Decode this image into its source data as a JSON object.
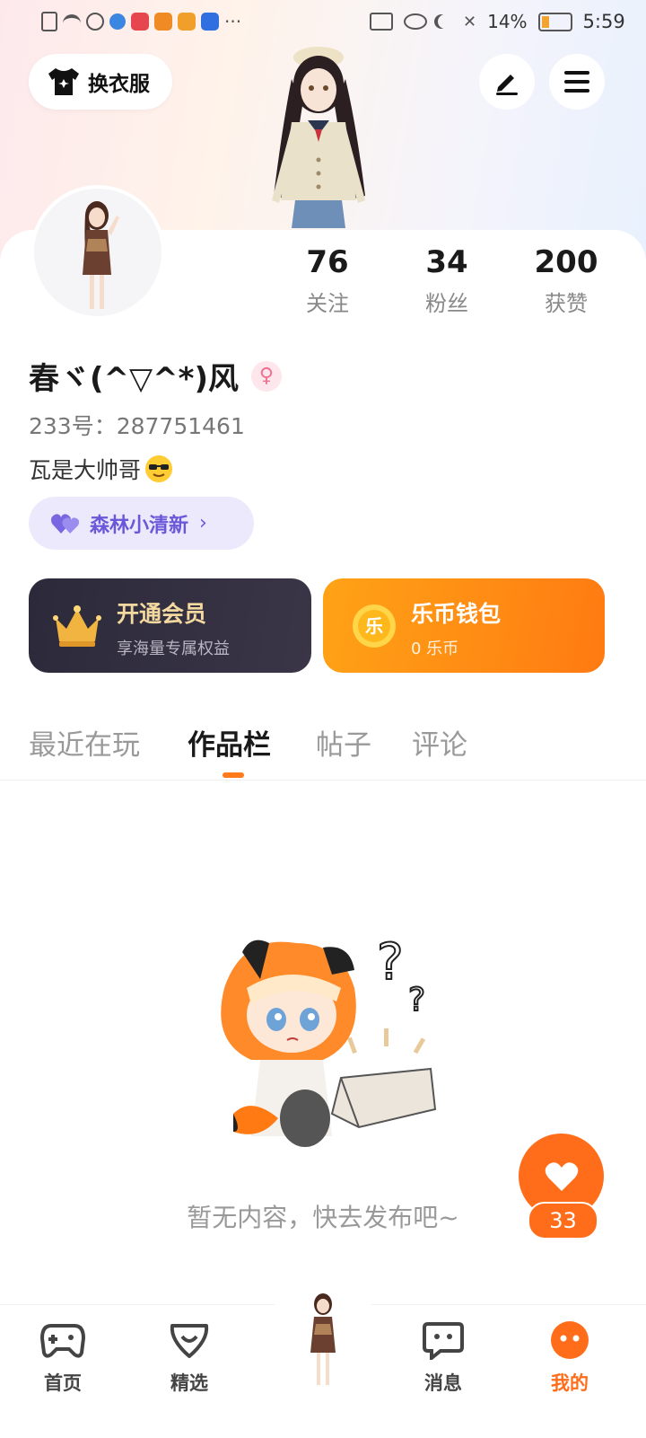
{
  "status_bar": {
    "battery": "14%",
    "time": "5:59"
  },
  "header": {
    "outfit_label": "换衣服",
    "edit_icon": "pen-icon",
    "menu_icon": "hamburger-menu-icon"
  },
  "profile": {
    "stats": [
      {
        "value": "76",
        "label": "关注"
      },
      {
        "value": "34",
        "label": "粉丝"
      },
      {
        "value": "200",
        "label": "获赞"
      }
    ],
    "username": "春ヾ(^▽^*)风",
    "gender_symbol": "♀",
    "uid": "233号：287751461",
    "bio": "瓦是大帅哥",
    "tag": "森林小清新"
  },
  "cards": {
    "vip_title": "开通会员",
    "vip_subtitle": "享海量专属权益",
    "wallet_title": "乐币钱包",
    "wallet_subtitle": "0 乐币",
    "coin_char": "乐"
  },
  "tabs": [
    {
      "label": "最近在玩",
      "active": false
    },
    {
      "label": "作品栏",
      "active": true
    },
    {
      "label": "帖子",
      "active": false
    },
    {
      "label": "评论",
      "active": false
    }
  ],
  "empty_state": {
    "text": "暂无内容，快去发布吧~"
  },
  "fab": {
    "count": "33"
  },
  "bottom_nav": [
    {
      "label": "首页",
      "icon": "gamepad-icon"
    },
    {
      "label": "精选",
      "icon": "heart-shield-icon"
    },
    {
      "label": "",
      "icon": "avatar-icon"
    },
    {
      "label": "消息",
      "icon": "chat-bubble-icon"
    },
    {
      "label": "我的",
      "icon": "profile-face-icon",
      "active": true
    }
  ],
  "colors": {
    "accent": "#ff6d1a",
    "tag_purple": "#6a58d8",
    "vip_gold": "#f3d9a0"
  }
}
